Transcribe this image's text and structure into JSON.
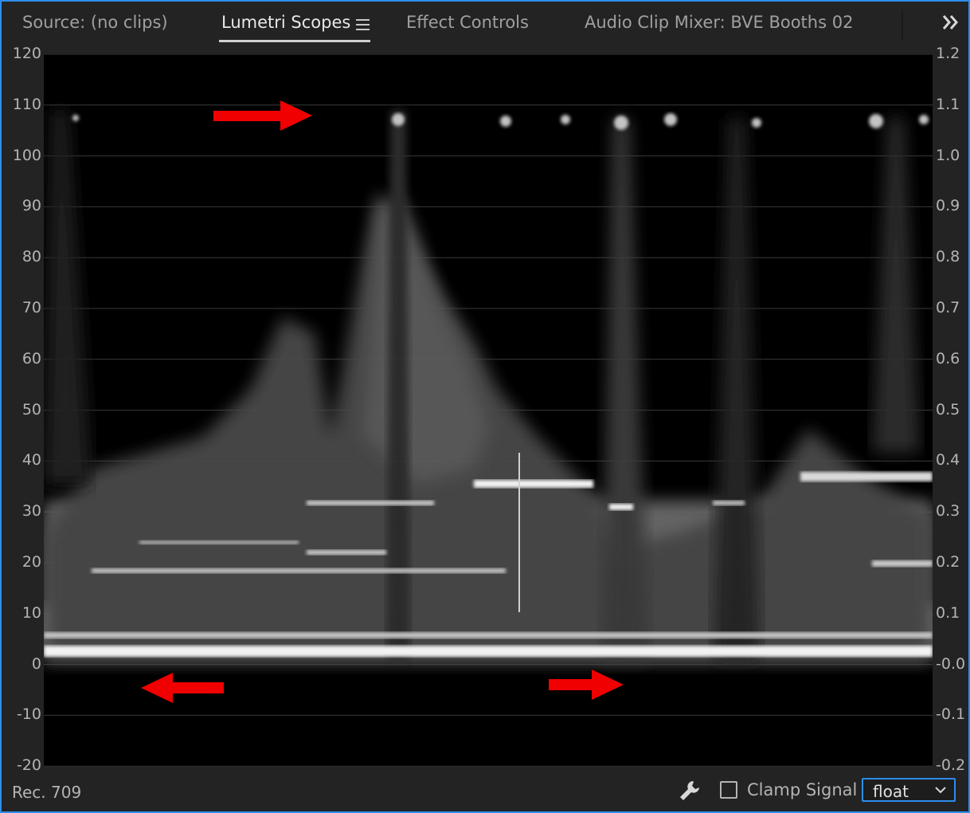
{
  "tabs": [
    {
      "label": "Source: (no clips)",
      "active": false
    },
    {
      "label": "Lumetri Scopes",
      "active": true
    },
    {
      "label": "Effect Controls",
      "active": false
    },
    {
      "label": "Audio Clip Mixer: BVE Booths 02",
      "active": false
    }
  ],
  "icons": {
    "panel_menu": "hamburger-menu-icon",
    "overflow": "double-chevron-right-icon",
    "settings": "wrench-icon",
    "dropdown": "chevron-down-icon",
    "annotation_arrows": [
      "red-arrow-right-icon",
      "red-arrow-left-icon",
      "red-arrow-right-icon"
    ]
  },
  "scope": {
    "type": "luma waveform",
    "left_axis_ticks": [
      "120",
      "110",
      "100",
      "90",
      "80",
      "70",
      "60",
      "50",
      "40",
      "30",
      "20",
      "10",
      "0",
      "-10",
      "-20"
    ],
    "right_axis_ticks": [
      "1.2",
      "1.1",
      "1.0",
      "0.9",
      "0.8",
      "0.7",
      "0.6",
      "0.5",
      "0.4",
      "0.3",
      "0.2",
      "0.1",
      "-0.0",
      "-0.1",
      "-0.2"
    ],
    "range": [
      -20,
      120
    ]
  },
  "footer": {
    "color_space": "Rec. 709",
    "clamp_label": "Clamp Signal",
    "clamp_checked": false,
    "bit_depth": "float"
  },
  "colors": {
    "accent": "#2d8ceb",
    "annotation": "#f00000",
    "panel_bg": "#232323",
    "scope_bg": "#000000"
  }
}
